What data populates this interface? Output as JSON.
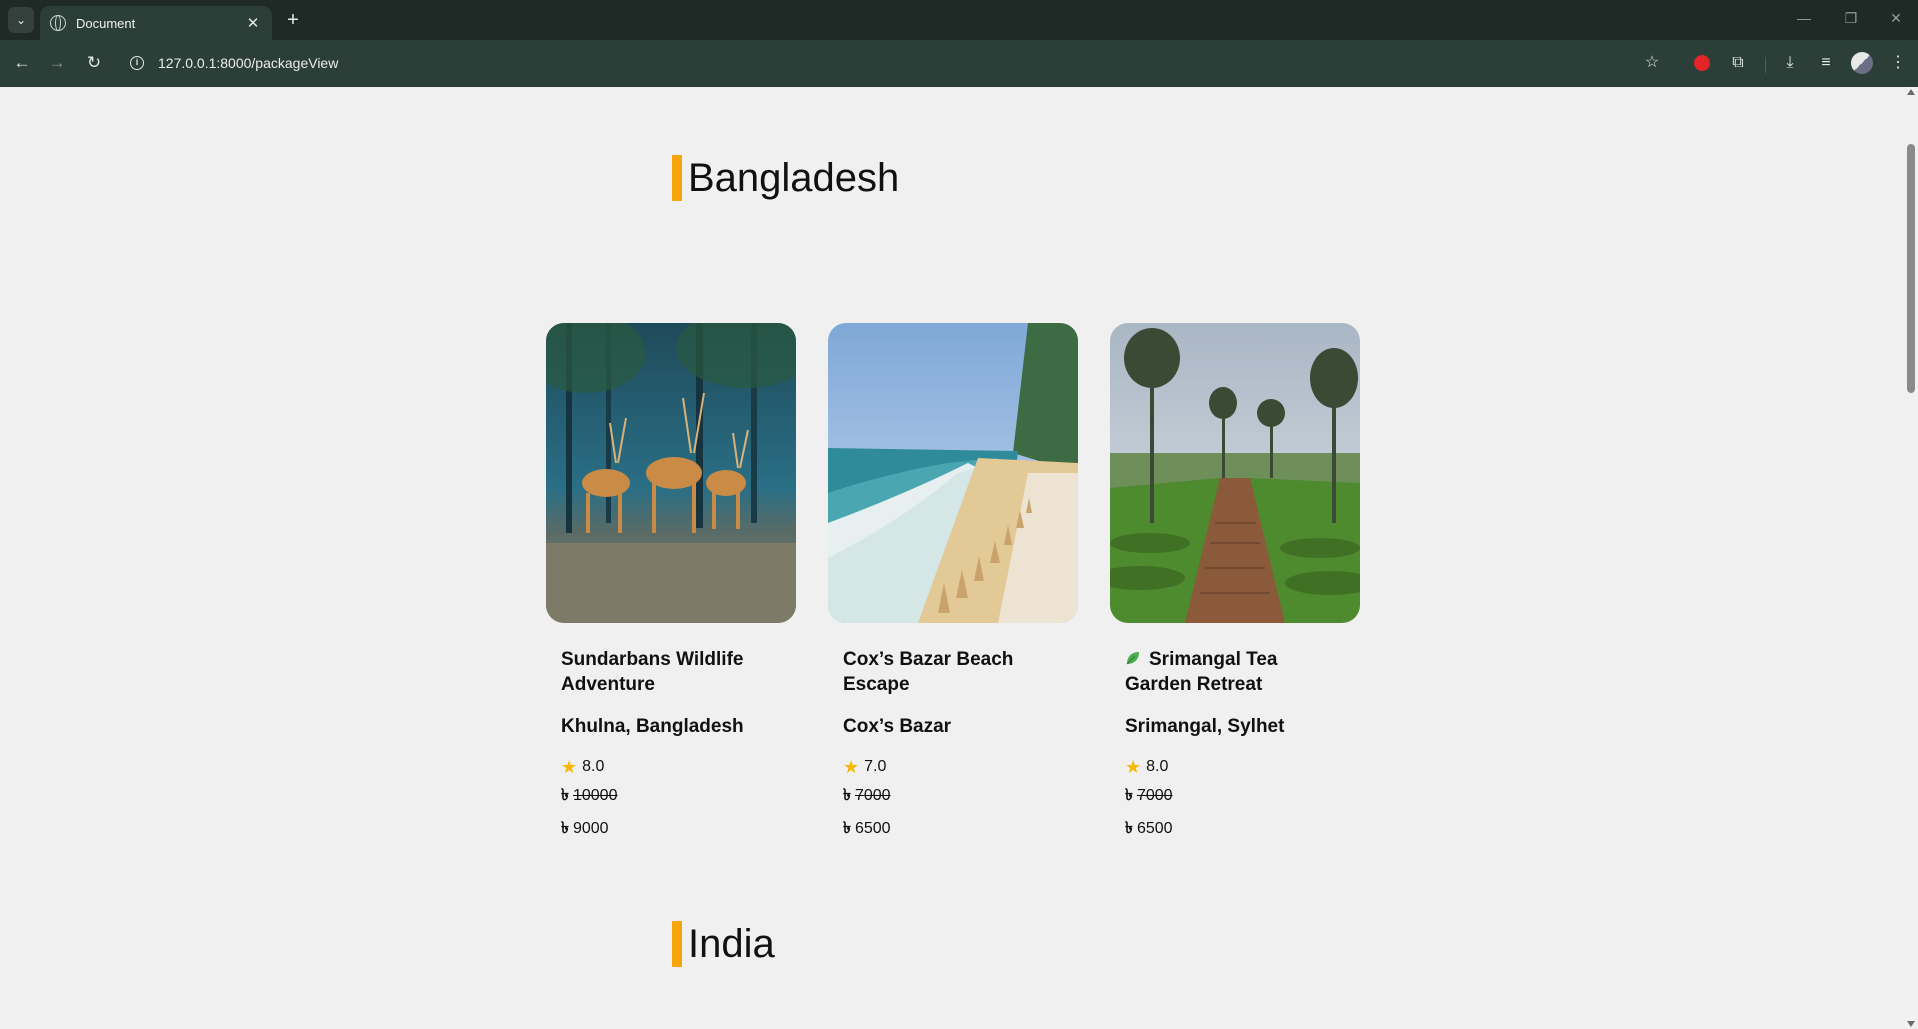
{
  "browser": {
    "tab_title": "Document",
    "tab_close": "✕",
    "new_tab": "+",
    "url": "127.0.0.1:8000/packageView",
    "window_controls": {
      "minimize": "—",
      "restore": "❐",
      "close": "✕"
    }
  },
  "sections": [
    {
      "name": "Bangladesh"
    },
    {
      "name": "India"
    }
  ],
  "currency_symbol": "৳",
  "rating_icon": "★",
  "packages": [
    {
      "title": "Sundarbans Wildlife Adventure",
      "location": "Khulna, Bangladesh",
      "rating": "8.0",
      "original_price": "10000",
      "price": "9000",
      "image": "deer-forest-photo"
    },
    {
      "title": "Cox’s Bazar Beach Escape",
      "location": "Cox’s Bazar",
      "rating": "7.0",
      "original_price": "7000",
      "price": "6500",
      "image": "beach-photo"
    },
    {
      "title": "Srimangal Tea Garden Retreat",
      "location": "Srimangal, Sylhet",
      "rating": "8.0",
      "original_price": "7000",
      "price": "6500",
      "image": "tea-garden-photo",
      "title_icon": "leaf-icon"
    }
  ],
  "colors": {
    "accent": "#f5a50a",
    "star": "#f6b800",
    "page_bg": "#f0f0f0",
    "chrome": "#2c3e38"
  }
}
